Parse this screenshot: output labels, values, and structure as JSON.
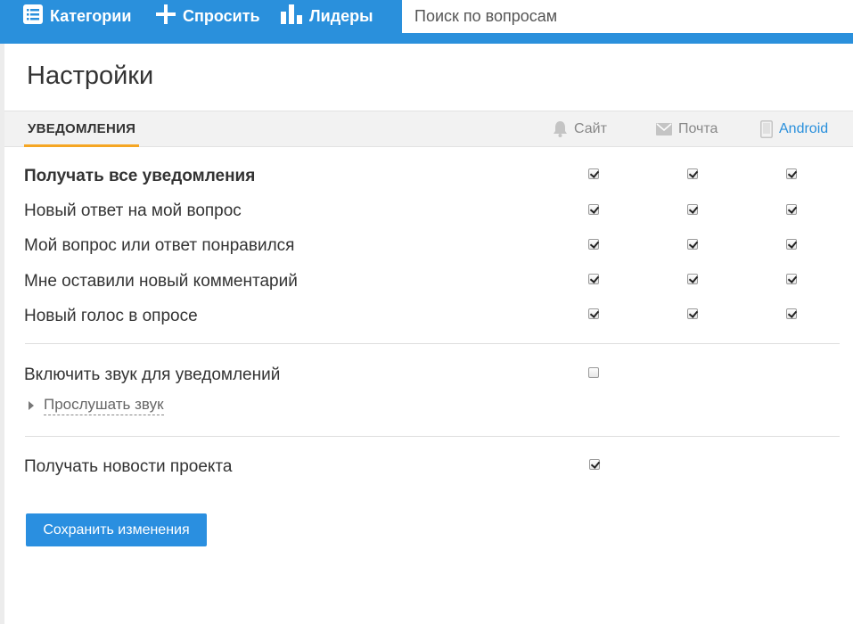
{
  "nav": {
    "categories": "Категории",
    "ask": "Спросить",
    "leaders": "Лидеры",
    "search_placeholder": "Поиск по вопросам"
  },
  "page": {
    "title": "Настройки"
  },
  "tabs": {
    "active": "УВЕДОМЛЕНИЯ"
  },
  "channels": [
    {
      "label": "Сайт",
      "icon": "bell-icon"
    },
    {
      "label": "Почта",
      "icon": "envelope-icon"
    },
    {
      "label": "Android",
      "icon": "phone-icon"
    }
  ],
  "notifications": [
    {
      "label": "Получать все уведомления",
      "site": true,
      "mail": true,
      "android": true
    },
    {
      "label": "Новый ответ на мой вопрос",
      "site": true,
      "mail": true,
      "android": true
    },
    {
      "label": "Мой вопрос или ответ понравился",
      "site": true,
      "mail": true,
      "android": true
    },
    {
      "label": "Мне оставили новый комментарий",
      "site": true,
      "mail": true,
      "android": true
    },
    {
      "label": "Новый голос в опросе",
      "site": true,
      "mail": true,
      "android": true
    }
  ],
  "sound": {
    "label": "Включить звук для уведомлений",
    "checked": false,
    "listen_label": "Прослушать звук"
  },
  "news": {
    "label": "Получать новости проекта",
    "checked": true
  },
  "save_button": "Сохранить изменения",
  "colors": {
    "topbar": "#2a90dc",
    "accent": "#f5a623",
    "link": "#2a90dc"
  }
}
